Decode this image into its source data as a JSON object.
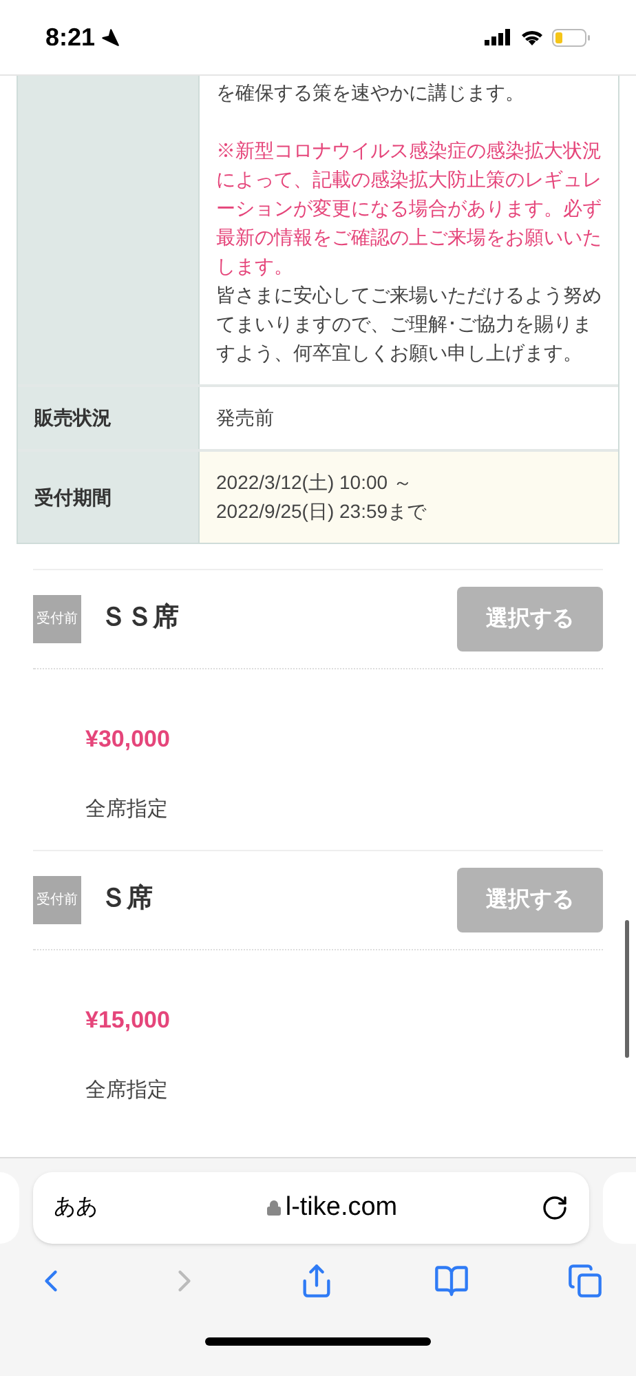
{
  "status_bar": {
    "time": "8:21"
  },
  "info_table": {
    "rows": [
      {
        "label": "",
        "paragraphs": [
          {
            "kind": "normal",
            "text": "を確保する策を速やかに講じます。"
          },
          {
            "kind": "notice",
            "text": "※新型コロナウイルス感染症の感染拡大状況によって、記載の感染拡大防止策のレギュレーションが変更になる場合があります。必ず最新の情報をご確認の上ご来場をお願いいたします。"
          },
          {
            "kind": "normal",
            "text": "皆さまに安心してご来場いただけるよう努めてまいりますので、ご理解･ご協力を賜りますよう、何卒宜しくお願い申し上げます。"
          }
        ],
        "highlight": false
      },
      {
        "label": "販売状況",
        "paragraphs": [
          {
            "kind": "normal",
            "text": "発売前"
          }
        ],
        "highlight": false
      },
      {
        "label": "受付期間",
        "paragraphs": [
          {
            "kind": "normal",
            "text": "2022/3/12(土) 10:00 ～"
          },
          {
            "kind": "normal",
            "text": "2022/9/25(日) 23:59まで"
          }
        ],
        "highlight": true
      }
    ]
  },
  "seats": [
    {
      "badge": "受付前",
      "name": "ＳＳ席",
      "button": "選択する",
      "disabled": true,
      "price": "¥30,000",
      "note": "全席指定"
    },
    {
      "badge": "受付前",
      "name": "Ｓ席",
      "button": "選択する",
      "disabled": true,
      "price": "¥15,000",
      "note": "全席指定"
    }
  ],
  "browser": {
    "text_size": "ああ",
    "url": "l-tike.com"
  }
}
